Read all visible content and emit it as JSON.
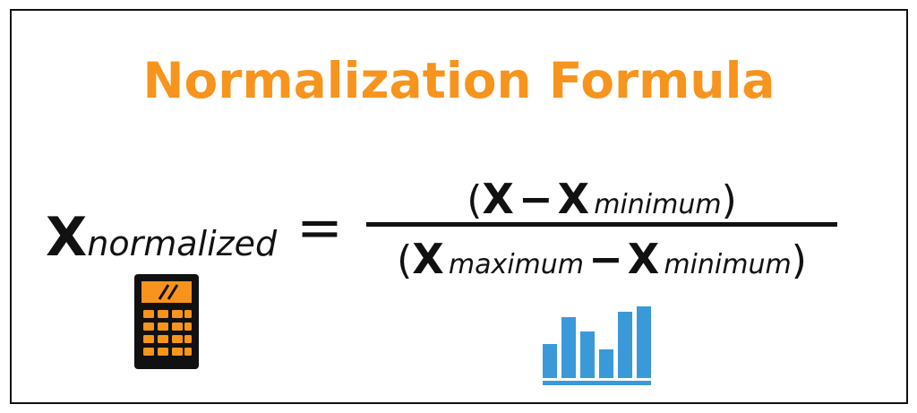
{
  "title": "Normalization Formula",
  "formula": {
    "lhs_var": "X",
    "lhs_sub": "normalized",
    "equals": "=",
    "numerator": {
      "open": "(",
      "x1": "X",
      "minus": "−",
      "x2": "X",
      "x2_sub": "minimum",
      "close": ")"
    },
    "denominator": {
      "open": "(",
      "x1": "X",
      "x1_sub": "maximum",
      "minus": "−",
      "x2": "X",
      "x2_sub": "minimum",
      "close": ")"
    }
  },
  "colors": {
    "title": "#f7941d",
    "calculator_orange": "#f7941d",
    "chart_blue": "#3a9ad9"
  },
  "icons": [
    "calculator-icon",
    "bar-chart-icon"
  ]
}
